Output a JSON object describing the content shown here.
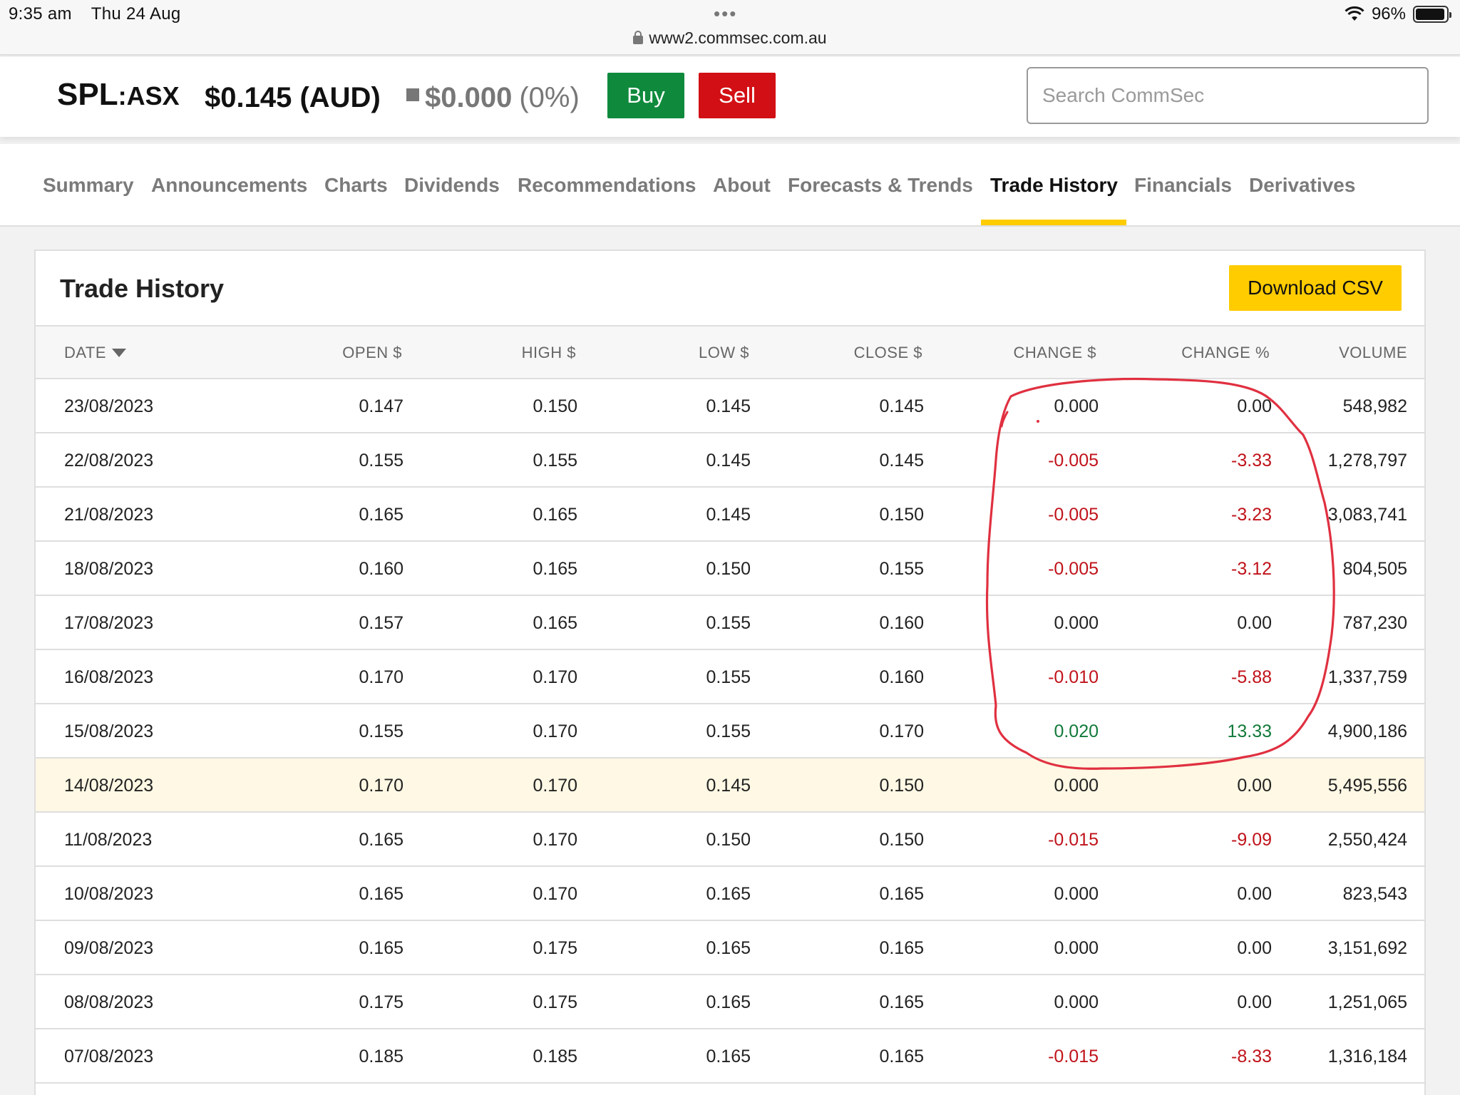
{
  "status": {
    "time": "9:35 am",
    "date": "Thu 24 Aug",
    "battery": "96%",
    "battery_level": 0.96,
    "url": "www2.commsec.com.au"
  },
  "quote": {
    "symbol": "SPL",
    "exchange": ":ASX",
    "price": "$0.145 (AUD)",
    "change": "$0.000",
    "change_pct": "(0%)",
    "buy_label": "Buy",
    "sell_label": "Sell",
    "search_placeholder": "Search CommSec"
  },
  "tabs": [
    {
      "label": "Summary",
      "active": false
    },
    {
      "label": "Announcements",
      "active": false
    },
    {
      "label": "Charts",
      "active": false
    },
    {
      "label": "Dividends",
      "active": false
    },
    {
      "label": "Recommendations",
      "active": false
    },
    {
      "label": "About",
      "active": false
    },
    {
      "label": "Forecasts & Trends",
      "active": false
    },
    {
      "label": "Trade History",
      "active": true
    },
    {
      "label": "Financials",
      "active": false
    },
    {
      "label": "Derivatives",
      "active": false
    }
  ],
  "card": {
    "title": "Trade History",
    "download_label": "Download CSV"
  },
  "table": {
    "columns": [
      "DATE",
      "OPEN $",
      "HIGH $",
      "LOW $",
      "CLOSE $",
      "CHANGE $",
      "CHANGE %",
      "VOLUME"
    ],
    "rows": [
      {
        "date": "23/08/2023",
        "open": "0.147",
        "high": "0.150",
        "low": "0.145",
        "close": "0.145",
        "change": "0.000",
        "change_pct": "0.00",
        "volume": "548,982",
        "trend": "flat"
      },
      {
        "date": "22/08/2023",
        "open": "0.155",
        "high": "0.155",
        "low": "0.145",
        "close": "0.145",
        "change": "-0.005",
        "change_pct": "-3.33",
        "volume": "1,278,797",
        "trend": "neg"
      },
      {
        "date": "21/08/2023",
        "open": "0.165",
        "high": "0.165",
        "low": "0.145",
        "close": "0.150",
        "change": "-0.005",
        "change_pct": "-3.23",
        "volume": "3,083,741",
        "trend": "neg"
      },
      {
        "date": "18/08/2023",
        "open": "0.160",
        "high": "0.165",
        "low": "0.150",
        "close": "0.155",
        "change": "-0.005",
        "change_pct": "-3.12",
        "volume": "804,505",
        "trend": "neg"
      },
      {
        "date": "17/08/2023",
        "open": "0.157",
        "high": "0.165",
        "low": "0.155",
        "close": "0.160",
        "change": "0.000",
        "change_pct": "0.00",
        "volume": "787,230",
        "trend": "flat"
      },
      {
        "date": "16/08/2023",
        "open": "0.170",
        "high": "0.170",
        "low": "0.155",
        "close": "0.160",
        "change": "-0.010",
        "change_pct": "-5.88",
        "volume": "1,337,759",
        "trend": "neg"
      },
      {
        "date": "15/08/2023",
        "open": "0.155",
        "high": "0.170",
        "low": "0.155",
        "close": "0.170",
        "change": "0.020",
        "change_pct": "13.33",
        "volume": "4,900,186",
        "trend": "pos"
      },
      {
        "date": "14/08/2023",
        "open": "0.170",
        "high": "0.170",
        "low": "0.145",
        "close": "0.150",
        "change": "0.000",
        "change_pct": "0.00",
        "volume": "5,495,556",
        "trend": "flat",
        "highlighted": true
      },
      {
        "date": "11/08/2023",
        "open": "0.165",
        "high": "0.170",
        "low": "0.150",
        "close": "0.150",
        "change": "-0.015",
        "change_pct": "-9.09",
        "volume": "2,550,424",
        "trend": "neg"
      },
      {
        "date": "10/08/2023",
        "open": "0.165",
        "high": "0.170",
        "low": "0.165",
        "close": "0.165",
        "change": "0.000",
        "change_pct": "0.00",
        "volume": "823,543",
        "trend": "flat"
      },
      {
        "date": "09/08/2023",
        "open": "0.165",
        "high": "0.175",
        "low": "0.165",
        "close": "0.165",
        "change": "0.000",
        "change_pct": "0.00",
        "volume": "3,151,692",
        "trend": "flat"
      },
      {
        "date": "08/08/2023",
        "open": "0.175",
        "high": "0.175",
        "low": "0.165",
        "close": "0.165",
        "change": "0.000",
        "change_pct": "0.00",
        "volume": "1,251,065",
        "trend": "flat"
      },
      {
        "date": "07/08/2023",
        "open": "0.185",
        "high": "0.185",
        "low": "0.165",
        "close": "0.165",
        "change": "-0.015",
        "change_pct": "-8.33",
        "volume": "1,316,184",
        "trend": "neg"
      }
    ]
  },
  "colors": {
    "buy": "#0f8a3c",
    "sell": "#d20f14",
    "accent": "#ffcc00",
    "negative": "#c0131b",
    "positive": "#127a3a",
    "annotation": "#e03040"
  },
  "icons": [
    "lock-icon",
    "wifi-icon",
    "battery-icon",
    "sort-down-icon",
    "more-dots-icon"
  ]
}
